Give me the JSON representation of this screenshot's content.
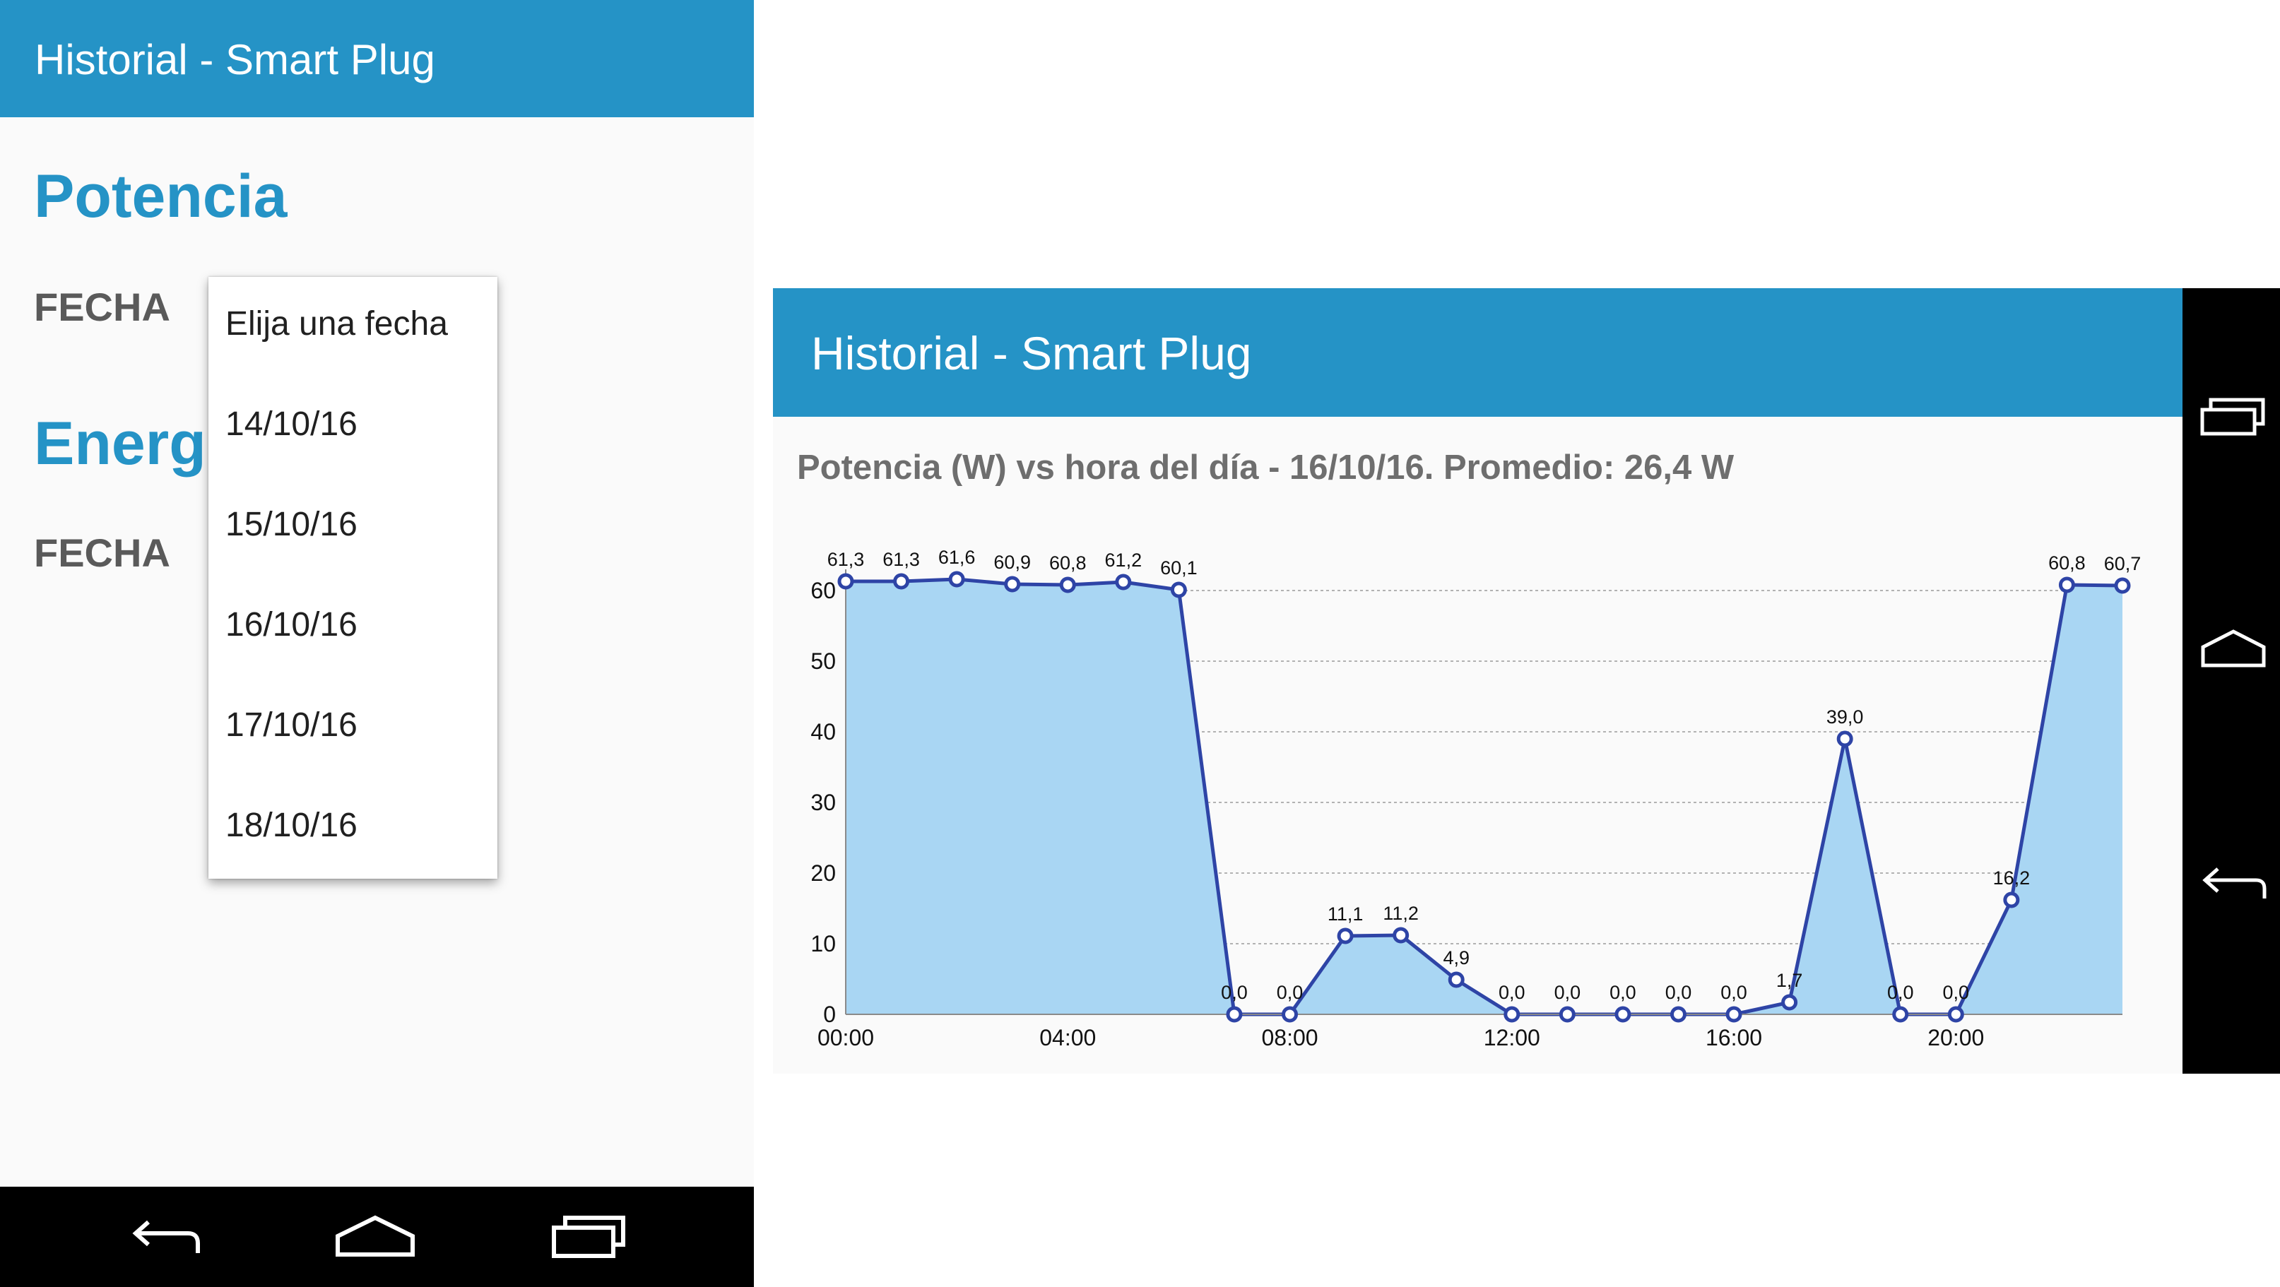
{
  "left_screen": {
    "app_title": "Historial - Smart Plug",
    "potencia_heading": "Potencia",
    "fecha_label_1": "FECHA",
    "energia_heading": "Energí",
    "fecha_label_2": "FECHA",
    "dropdown": {
      "options": [
        "Elija una fecha",
        "14/10/16",
        "15/10/16",
        "16/10/16",
        "17/10/16",
        "18/10/16"
      ]
    },
    "navbar": {
      "icons": [
        "back-icon",
        "home-icon",
        "recents-icon"
      ]
    }
  },
  "right_screen": {
    "app_title": "Historial - Smart Plug",
    "chart_title": "Potencia (W) vs hora del día - 16/10/16. Promedio: 26,4 W",
    "navbar": {
      "icons": [
        "recents-icon",
        "home-icon",
        "back-icon"
      ]
    }
  },
  "colors": {
    "accent": "#2593c6",
    "line": "#2e44a6",
    "area": "#a9d6f3"
  },
  "chart_data": {
    "type": "area",
    "title": "Potencia (W) vs hora del día - 16/10/16. Promedio: 26,4 W",
    "x_unit": "hours",
    "x": [
      0,
      1,
      2,
      3,
      4,
      5,
      6,
      7,
      8,
      9,
      10,
      11,
      12,
      13,
      14,
      15,
      16,
      17,
      18,
      19,
      20,
      21,
      22,
      23
    ],
    "values": [
      61.3,
      61.3,
      61.6,
      60.9,
      60.8,
      61.2,
      60.1,
      0.0,
      0.0,
      11.1,
      11.2,
      4.9,
      0.0,
      0.0,
      0.0,
      0.0,
      0.0,
      1.7,
      39.0,
      0.0,
      0.0,
      16.2,
      60.8,
      60.7
    ],
    "data_labels": [
      "61,3",
      "61,3",
      "61,6",
      "60,9",
      "60,8",
      "61,2",
      "60,1",
      "0,0",
      "0,0",
      "11,1",
      "11,2",
      "4,9",
      "0,0",
      "0,0",
      "0,0",
      "0,0",
      "0,0",
      "1,7",
      "39,0",
      "0,0",
      "0,0",
      "16,2",
      "60,8",
      "60,7"
    ],
    "x_ticks": [
      {
        "x": 0,
        "label": "00:00"
      },
      {
        "x": 4,
        "label": "04:00"
      },
      {
        "x": 8,
        "label": "08:00"
      },
      {
        "x": 12,
        "label": "12:00"
      },
      {
        "x": 16,
        "label": "16:00"
      },
      {
        "x": 20,
        "label": "20:00"
      }
    ],
    "y_ticks": [
      0,
      10,
      20,
      30,
      40,
      50,
      60
    ],
    "xlim": [
      0,
      23
    ],
    "ylim": [
      0,
      60
    ],
    "grid": "horizontal dashed",
    "legend": "none"
  }
}
